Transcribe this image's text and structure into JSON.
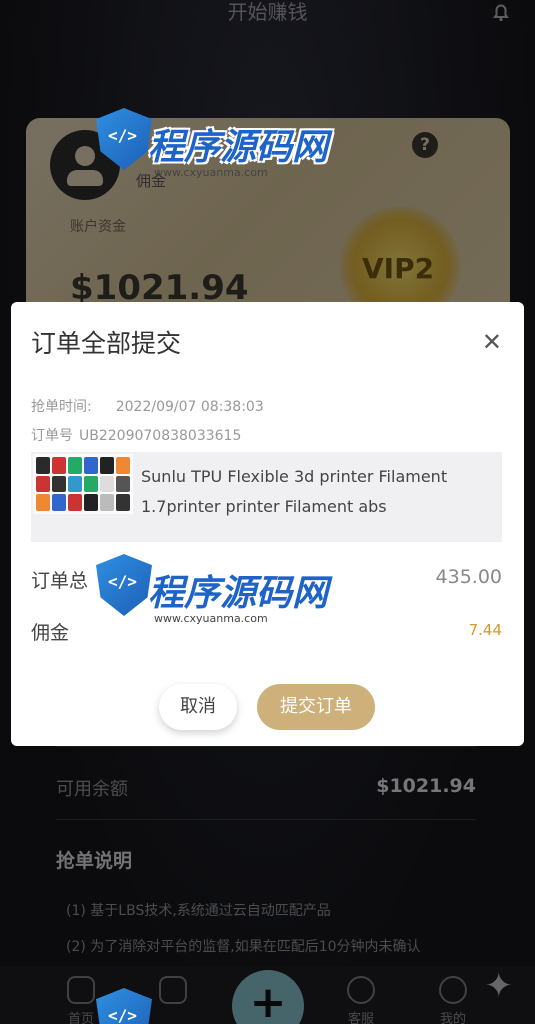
{
  "header": {
    "title": "开始赚钱"
  },
  "card": {
    "commission_label": "佣金",
    "account_label": "账户资金",
    "balance": "$1021.94",
    "vip_level": "VIP2"
  },
  "modal": {
    "title": "订单全部提交",
    "grab_time_label": "抢单时间:",
    "grab_time": "2022/09/07 08:38:03",
    "order_no_label": "订单号",
    "order_no": "UB2209070838033615",
    "product_name": "Sunlu TPU Flexible 3d printer Filament 1.7printer printer Filament abs",
    "total_label": "订单总",
    "total_value": "435.00",
    "commission_label": "佣金",
    "commission_value": "7.44",
    "cancel_label": "取消",
    "submit_label": "提交订单"
  },
  "panel": {
    "available_label": "可用余额",
    "available_value": "$1021.94",
    "rules_title": "抢单说明",
    "rules": [
      "(1) 基于LBS技术,系统通过云自动匹配产品",
      "(2) 为了消除对平台的监督,如果在匹配后10分钟内未确认"
    ]
  },
  "nav": {
    "items": [
      {
        "label": "首页",
        "icon": "home-icon"
      },
      {
        "label": "",
        "icon": "orders-icon"
      },
      {
        "label": "",
        "icon": "plus-icon"
      },
      {
        "label": "客服",
        "icon": "chat-icon"
      },
      {
        "label": "我的",
        "icon": "user-icon"
      }
    ]
  },
  "watermark": {
    "brand": "程序源码网",
    "url": "www.cxyuanma.com"
  },
  "colors": {
    "gold": "#cdb07a",
    "commission": "#d29a2a",
    "watermark": "#1e63c8"
  }
}
